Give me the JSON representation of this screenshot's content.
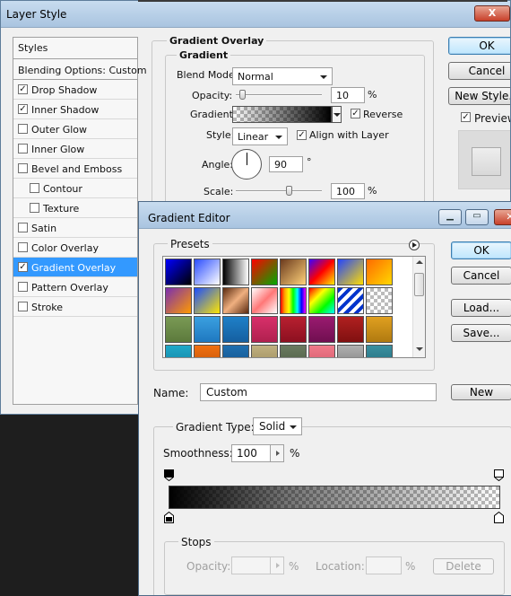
{
  "layer_style": {
    "title": "Layer Style",
    "close_label": "X",
    "styles_header": "Styles",
    "blending_options": "Blending Options: Custom",
    "items": [
      {
        "label": "Drop Shadow",
        "checked": true
      },
      {
        "label": "Inner Shadow",
        "checked": true
      },
      {
        "label": "Outer Glow",
        "checked": false
      },
      {
        "label": "Inner Glow",
        "checked": false
      },
      {
        "label": "Bevel and Emboss",
        "checked": false
      },
      {
        "label": "Contour",
        "checked": false
      },
      {
        "label": "Texture",
        "checked": false
      },
      {
        "label": "Satin",
        "checked": false
      },
      {
        "label": "Color Overlay",
        "checked": false
      },
      {
        "label": "Gradient Overlay",
        "checked": true
      },
      {
        "label": "Pattern Overlay",
        "checked": false
      },
      {
        "label": "Stroke",
        "checked": false
      }
    ],
    "section_title": "Gradient Overlay",
    "gradient_group": "Gradient",
    "blend_mode_label": "Blend Mode:",
    "blend_mode_value": "Normal",
    "opacity_label": "Opacity:",
    "opacity_value": "10",
    "opacity_unit": "%",
    "gradient_label": "Gradient:",
    "reverse_label": "Reverse",
    "style_label": "Style:",
    "style_value": "Linear",
    "align_label": "Align with Layer",
    "angle_label": "Angle:",
    "angle_value": "90",
    "angle_unit": "°",
    "scale_label": "Scale:",
    "scale_value": "100",
    "scale_unit": "%",
    "ok": "OK",
    "cancel": "Cancel",
    "new_style": "New Style...",
    "preview": "Preview"
  },
  "gradient_editor": {
    "title": "Gradient Editor",
    "presets_label": "Presets",
    "ok": "OK",
    "cancel": "Cancel",
    "load": "Load...",
    "save": "Save...",
    "name_label": "Name:",
    "name_value": "Custom",
    "new_button": "New",
    "gradient_type_label": "Gradient Type:",
    "gradient_type_value": "Solid",
    "smoothness_label": "Smoothness:",
    "smoothness_value": "100",
    "smoothness_unit": "%",
    "stops_label": "Stops",
    "stop_opacity_label": "Opacity:",
    "stop_location_label": "Location:",
    "percent": "%",
    "delete": "Delete"
  },
  "colors": {
    "selection": "#3399ff",
    "title_bar": "#b9d1ea",
    "close_red": "#c8402a"
  }
}
